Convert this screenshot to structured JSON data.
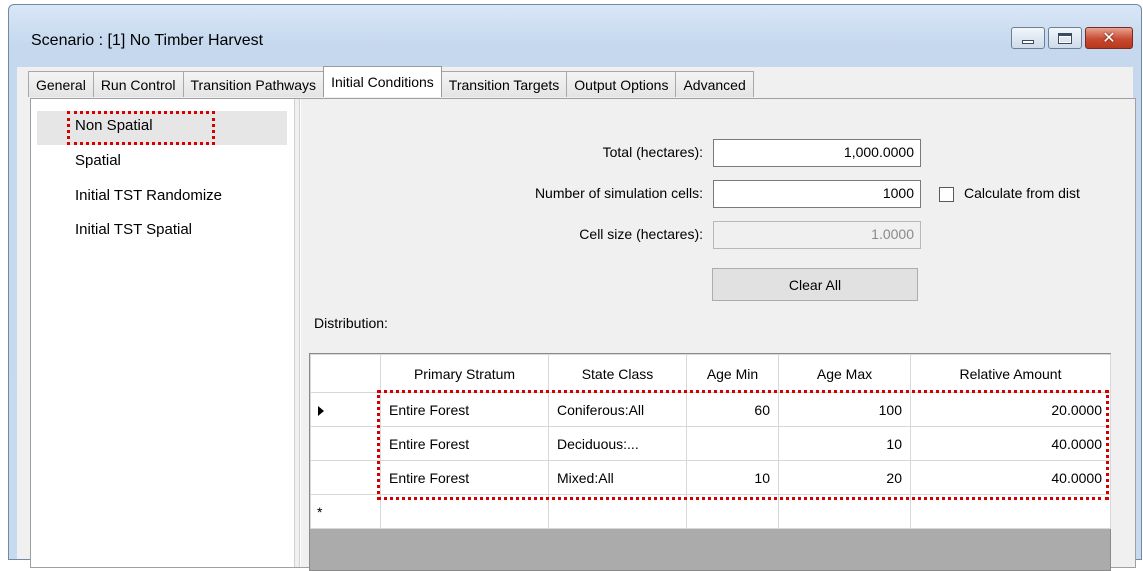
{
  "window": {
    "title": "Scenario : [1] No Timber Harvest",
    "controls": {
      "minimize": "minimize-icon",
      "maximize": "maximize-icon",
      "close": "close-icon"
    }
  },
  "tabs": [
    "General",
    "Run Control",
    "Transition Pathways",
    "Initial Conditions",
    "Transition Targets",
    "Output Options",
    "Advanced"
  ],
  "active_tab": "Initial Conditions",
  "nav": {
    "items": [
      "Non Spatial",
      "Spatial",
      "Initial TST Randomize",
      "Initial TST Spatial"
    ],
    "selected": "Non Spatial"
  },
  "form": {
    "total_label": "Total (hectares):",
    "total_value": "1,000.0000",
    "cells_label": "Number of simulation cells:",
    "cells_value": "1000",
    "calc_label": "Calculate from dist",
    "calc_checked": false,
    "cellsize_label": "Cell size (hectares):",
    "cellsize_value": "1.0000",
    "clear_label": "Clear All",
    "distribution_label": "Distribution:"
  },
  "grid": {
    "columns": [
      "Primary Stratum",
      "State Class",
      "Age Min",
      "Age Max",
      "Relative Amount"
    ],
    "rows": [
      [
        "Entire Forest",
        "Coniferous:All",
        "60",
        "100",
        "20.0000"
      ],
      [
        "Entire Forest",
        "Deciduous:...",
        "",
        "10",
        "40.0000"
      ],
      [
        "Entire Forest",
        "Mixed:All",
        "10",
        "20",
        "40.0000"
      ]
    ],
    "new_row_marker": "*"
  },
  "colors": {
    "highlight": "#d40000",
    "nav_selected": "#e6e6e6"
  }
}
